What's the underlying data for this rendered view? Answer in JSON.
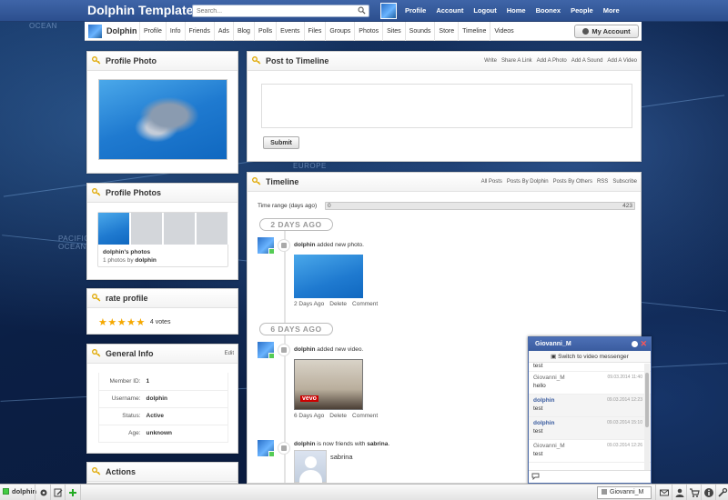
{
  "header": {
    "site_title": "Dolphin Template",
    "search_placeholder": "Search...",
    "nav": [
      "Profile",
      "Account",
      "Logout",
      "Home",
      "Boonex",
      "People",
      "More"
    ]
  },
  "submenu": {
    "profile_name": "Dolphin",
    "items": [
      "Profile",
      "Info",
      "Friends",
      "Ads",
      "Blog",
      "Polls",
      "Events",
      "Files",
      "Groups",
      "Photos",
      "Sites",
      "Sounds",
      "Store",
      "Timeline",
      "Videos"
    ],
    "my_account_label": "My Account"
  },
  "background": {
    "labels": [
      "OCEAN",
      "PACIFIC",
      "OCEAN",
      "EUROPE"
    ]
  },
  "left": {
    "profile_photo_title": "Profile Photo",
    "profile_photos_title": "Profile Photos",
    "album_title": "dolphin's photos",
    "album_count": "1 photos by",
    "album_owner": "dolphin",
    "rate_title": "rate profile",
    "rating": 5,
    "votes_label": "4 votes",
    "general_info_title": "General Info",
    "edit_label": "Edit",
    "info_rows": [
      {
        "label": "Member ID:",
        "value": "1"
      },
      {
        "label": "Username:",
        "value": "dolphin"
      },
      {
        "label": "Status:",
        "value": "Active"
      },
      {
        "label": "Age:",
        "value": "unknown"
      }
    ],
    "actions_title": "Actions"
  },
  "post": {
    "title": "Post to Timeline",
    "actions": [
      "Write",
      "Share A Link",
      "Add A Photo",
      "Add A Sound",
      "Add A Video"
    ],
    "submit_label": "Submit"
  },
  "timeline": {
    "title": "Timeline",
    "actions": [
      "All Posts",
      "Posts By Dolphin",
      "Posts By Others",
      "RSS",
      "Subscribe"
    ],
    "range_label": "Time range (days ago)",
    "range_min": "0",
    "range_max": "423",
    "groups": [
      {
        "label": "2 DAYS AGO",
        "entries": [
          {
            "user": "dolphin",
            "text": "added new photo.",
            "meta": [
              "2 Days Ago",
              "Delete",
              "Comment"
            ]
          }
        ]
      },
      {
        "label": "6 DAYS AGO",
        "entries": [
          {
            "user": "dolphin",
            "text": "added new video.",
            "meta": [
              "6 Days Ago",
              "Delete",
              "Comment"
            ],
            "video_brand": "vevo"
          },
          {
            "user": "dolphin",
            "text": "is now friends with",
            "friend": "sabrina",
            "friend_name": "sabrina"
          }
        ]
      }
    ]
  },
  "chat": {
    "title": "Giovanni_M",
    "switch_label": "Switch to video messenger",
    "first_line": "test",
    "messages": [
      {
        "who": "Giovanni_M",
        "time": "09.03.2014 11:40",
        "body": "hello",
        "me": false
      },
      {
        "who": "dolphin",
        "time": "09.03.2014 12:23",
        "body": "test",
        "me": true
      },
      {
        "who": "dolphin",
        "time": "09.03.2014 15:10",
        "body": "test",
        "me": true
      },
      {
        "who": "Giovanni_M",
        "time": "09.03.2014 12:26",
        "body": "test",
        "me": false
      }
    ]
  },
  "bottombar": {
    "username": "dolphin",
    "chat_tab": "Giovanni_M"
  },
  "colors": {
    "header_blue": "#3f65a8",
    "star": "#f5a800",
    "online": "#44cc44",
    "chat_close": "#ff5555"
  }
}
